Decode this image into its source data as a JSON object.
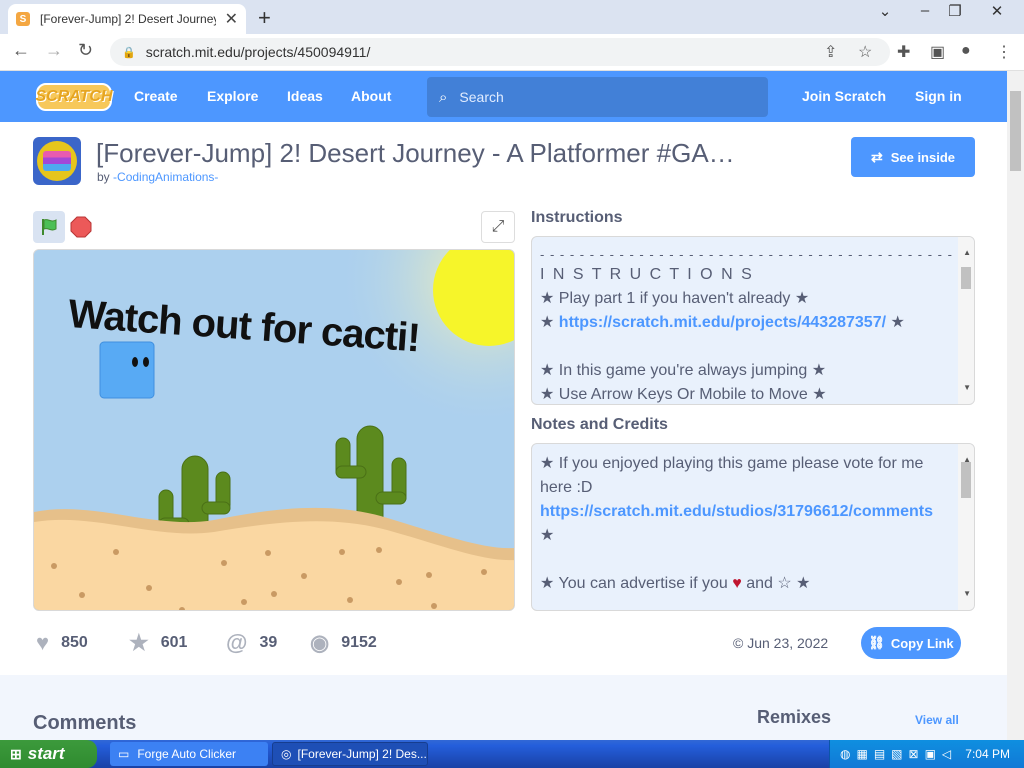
{
  "browser": {
    "tab_title": "[Forever-Jump] 2! Desert Journey",
    "url": "scratch.mit.edu/projects/450094911/"
  },
  "navbar": {
    "logo_text": "SCRATCH",
    "links": [
      "Create",
      "Explore",
      "Ideas",
      "About"
    ],
    "search_placeholder": "Search",
    "join": "Join Scratch",
    "signin": "Sign in"
  },
  "project": {
    "title": "[Forever-Jump] 2! Desert Journey - A Platformer #GA…",
    "by": "by",
    "author": "-CodingAnimations-",
    "see_inside": "See inside",
    "stage_text": "Watch out for cacti!"
  },
  "stats": {
    "loves": "850",
    "favorites": "601",
    "remixes": "39",
    "views": "9152",
    "date": "© Jun 23, 2022",
    "copy_link": "Copy Link"
  },
  "instructions": {
    "title": "Instructions",
    "lines": [
      "- - - - - - - - - - - - - - - - - - - - - - - - - - - - - - - - - - - - - - - - - -",
      "I N S T R U C T I O N S",
      "★ Play part 1 if you haven't already ★"
    ],
    "link_prefix": "★ ",
    "link": "https://scratch.mit.edu/projects/443287357/",
    "link_suffix": " ★",
    "lines_after": [
      "",
      "★ In this game you're always jumping ★",
      "★ Use Arrow Keys Or Mobile to Move ★"
    ]
  },
  "notes": {
    "title": "Notes and Credits",
    "line1": "★ If you enjoyed playing this game please vote for me",
    "line2": "here :D",
    "link": "https://scratch.mit.edu/studios/31796612/comments",
    "line3": "★",
    "line5_a": "★ You can advertise if you ",
    "heart": "♥",
    "line5_b": " and ☆ ★"
  },
  "lower": {
    "comments": "Comments",
    "remixes": "Remixes",
    "view_all": "View all"
  },
  "taskbar": {
    "start": "start",
    "item1": "Forge Auto Clicker",
    "item2": "[Forever-Jump] 2! Des...",
    "clock": "7:04 PM"
  },
  "colors": {
    "scratch_blue": "#4d97ff",
    "text_gray": "#575e75",
    "heart_red": "#c0152f"
  }
}
